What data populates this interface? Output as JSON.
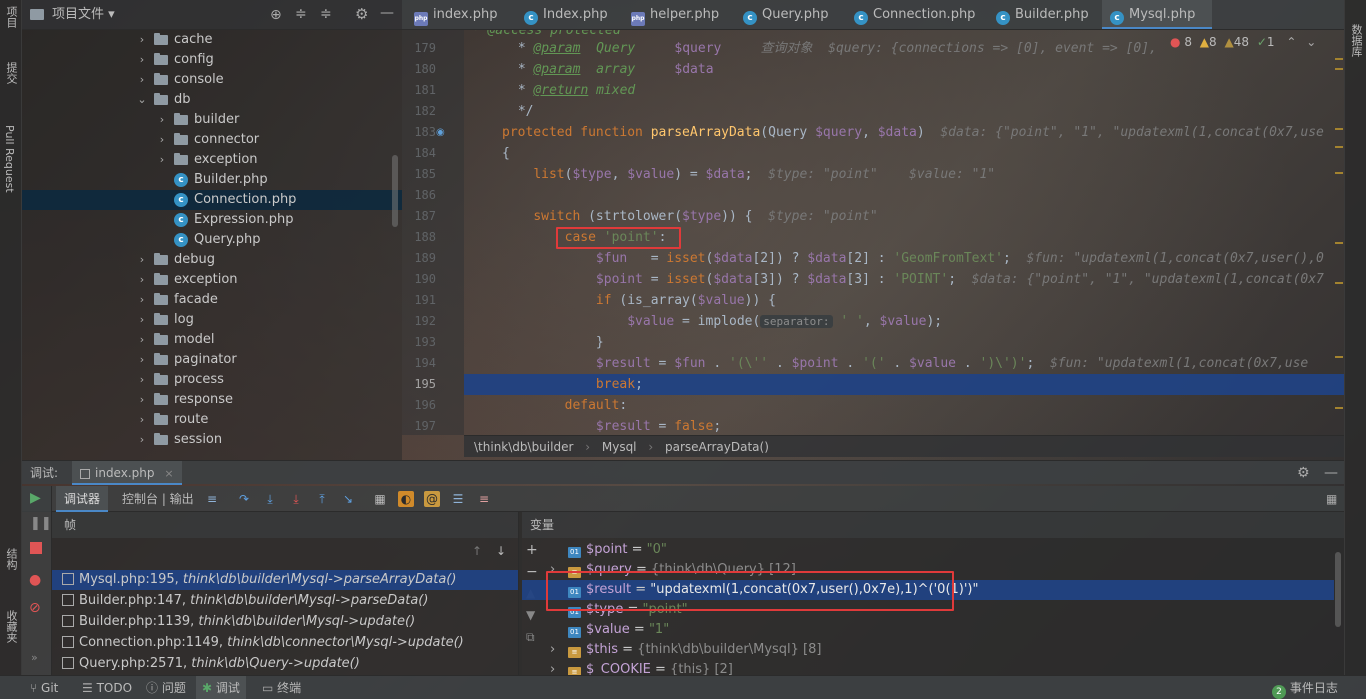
{
  "left_sidebar": {
    "tabs": [
      "项目",
      "提交",
      "Pull Request",
      "结构",
      "收藏夹"
    ]
  },
  "right_sidebar": {
    "tabs": [
      "数据库"
    ]
  },
  "project": {
    "title": "项目文件",
    "tree": [
      {
        "name": "cache",
        "type": "folder",
        "depth": 3,
        "expanded": false
      },
      {
        "name": "config",
        "type": "folder",
        "depth": 3,
        "expanded": false
      },
      {
        "name": "console",
        "type": "folder",
        "depth": 3,
        "expanded": false
      },
      {
        "name": "db",
        "type": "folder",
        "depth": 3,
        "expanded": true
      },
      {
        "name": "builder",
        "type": "folder",
        "depth": 4,
        "expanded": false
      },
      {
        "name": "connector",
        "type": "folder",
        "depth": 4,
        "expanded": false
      },
      {
        "name": "exception",
        "type": "folder",
        "depth": 4,
        "expanded": false
      },
      {
        "name": "Builder.php",
        "type": "class",
        "depth": 4
      },
      {
        "name": "Connection.php",
        "type": "class",
        "depth": 4,
        "selected": true
      },
      {
        "name": "Expression.php",
        "type": "class",
        "depth": 4
      },
      {
        "name": "Query.php",
        "type": "class",
        "depth": 4
      },
      {
        "name": "debug",
        "type": "folder",
        "depth": 3,
        "expanded": false
      },
      {
        "name": "exception",
        "type": "folder",
        "depth": 3,
        "expanded": false
      },
      {
        "name": "facade",
        "type": "folder",
        "depth": 3,
        "expanded": false
      },
      {
        "name": "log",
        "type": "folder",
        "depth": 3,
        "expanded": false
      },
      {
        "name": "model",
        "type": "folder",
        "depth": 3,
        "expanded": false
      },
      {
        "name": "paginator",
        "type": "folder",
        "depth": 3,
        "expanded": false
      },
      {
        "name": "process",
        "type": "folder",
        "depth": 3,
        "expanded": false
      },
      {
        "name": "response",
        "type": "folder",
        "depth": 3,
        "expanded": false
      },
      {
        "name": "route",
        "type": "folder",
        "depth": 3,
        "expanded": false
      },
      {
        "name": "session",
        "type": "folder",
        "depth": 3,
        "expanded": false
      }
    ]
  },
  "tabs": [
    {
      "label": "index.php",
      "kind": "php"
    },
    {
      "label": "Index.php",
      "kind": "class"
    },
    {
      "label": "helper.php",
      "kind": "php"
    },
    {
      "label": "Query.php",
      "kind": "class"
    },
    {
      "label": "Connection.php",
      "kind": "class"
    },
    {
      "label": "Builder.php",
      "kind": "class"
    },
    {
      "label": "Mysql.php",
      "kind": "class",
      "active": true
    }
  ],
  "inspections": {
    "errors": "8",
    "warnings": "8",
    "weak": "48",
    "ok": "1"
  },
  "editor": {
    "current_line": 195,
    "lines": [
      {
        "n": 179,
        "html": " * <span class='doc'>@param</span>  <span class='cmt'>Query</span>     <span class='var'>$query</span>     <span class='hint'>查询对象  $query: {connections => [0], event => [0], </span>"
      },
      {
        "n": 180,
        "html": " * <span class='doc'>@param</span>  <span class='cmt'>array</span>     <span class='var'>$data</span>"
      },
      {
        "n": 181,
        "html": " * <span class='doc'>@return</span> <span class='cmt'>mixed</span>"
      },
      {
        "n": 182,
        "html": " */"
      },
      {
        "n": 183,
        "html": "<span class='kw'>protected function</span> <span class='fn'>parseArrayData</span>(Query <span class='var'>$query</span>, <span class='var'>$data</span>)  <span class='hint'>$data: {\"point\", \"1\", \"updatexml(1,concat(0x7,use</span>"
      },
      {
        "n": 184,
        "html": "{"
      },
      {
        "n": 185,
        "html": "    <span class='kw'>list</span>(<span class='var'>$type</span>, <span class='var'>$value</span>) = <span class='var'>$data</span>;  <span class='hint'>$type: \"point\"    $value: \"1\"</span>"
      },
      {
        "n": 186,
        "html": ""
      },
      {
        "n": 187,
        "html": "    <span class='kw'>switch</span> (strtolower(<span class='var'>$type</span>)) {  <span class='hint'>$type: \"point\"</span>"
      },
      {
        "n": 188,
        "html": "        <span class='kw'>case</span> <span class='str'>'point'</span>:"
      },
      {
        "n": 189,
        "html": "            <span class='var'>$fun</span>   = <span class='kw'>isset</span>(<span class='var'>$data</span>[2]) ? <span class='var'>$data</span>[2] : <span class='str'>'GeomFromText'</span>;  <span class='hint'>$fun: \"updatexml(1,concat(0x7,user(),0</span>"
      },
      {
        "n": 190,
        "html": "            <span class='var'>$point</span> = <span class='kw'>isset</span>(<span class='var'>$data</span>[3]) ? <span class='var'>$data</span>[3] : <span class='str'>'POINT'</span>;  <span class='hint'>$data: {\"point\", \"1\", \"updatexml(1,concat(0x7</span>"
      },
      {
        "n": 191,
        "html": "            <span class='kw'>if</span> (is_array(<span class='var'>$value</span>)) {"
      },
      {
        "n": 192,
        "html": "                <span class='var'>$value</span> = implode(<span class='inlay'>separator:</span> <span class='str'>' '</span>, <span class='var'>$value</span>);"
      },
      {
        "n": 193,
        "html": "            }"
      },
      {
        "n": 194,
        "html": "            <span class='var'>$result</span> = <span class='var'>$fun</span> . <span class='str'>'(\\''</span> . <span class='var'>$point</span> . <span class='str'>'('</span> . <span class='var'>$value</span> . <span class='str'>')\\')'</span>;  <span class='hint'>$fun: \"updatexml(1,concat(0x7,use</span>"
      },
      {
        "n": 195,
        "html": "            <span class='kw'>break</span>;"
      },
      {
        "n": 196,
        "html": "        <span class='kw'>default</span>:"
      },
      {
        "n": 197,
        "html": "            <span class='var'>$result</span> = <span class='kw'>false</span>;"
      }
    ]
  },
  "breadcrumb": [
    "\\think\\db\\builder",
    "Mysql",
    "parseArrayData()"
  ],
  "debug": {
    "label": "调试:",
    "session": "index.php",
    "tab_debugger": "调试器",
    "tab_console": "控制台 | 输出",
    "frames_header": "帧",
    "vars_header": "变量",
    "frames": [
      {
        "loc": "Mysql.php:195,",
        "fn": "think\\db\\builder\\Mysql->parseArrayData()",
        "selected": true
      },
      {
        "loc": "Builder.php:147,",
        "fn": "think\\db\\builder\\Mysql->parseData()"
      },
      {
        "loc": "Builder.php:1139,",
        "fn": "think\\db\\builder\\Mysql->update()"
      },
      {
        "loc": "Connection.php:1149,",
        "fn": "think\\db\\connector\\Mysql->update()"
      },
      {
        "loc": "Query.php:2571,",
        "fn": "think\\db\\Query->update()"
      }
    ],
    "variables": [
      {
        "name": "$point",
        "eq": " = ",
        "value": "\"0\"",
        "kind": "str"
      },
      {
        "name": "$query",
        "eq": " = ",
        "value": "{think\\db\\Query} [12]",
        "kind": "obj",
        "expandable": true
      },
      {
        "name": "$result",
        "eq": " = ",
        "value": "\"updatexml(1,concat(0x7,user(),0x7e),1)^('0(1)')\"",
        "kind": "str",
        "selected": true
      },
      {
        "name": "$type",
        "eq": " = ",
        "value": "\"point\"",
        "kind": "str"
      },
      {
        "name": "$value",
        "eq": " = ",
        "value": "\"1\"",
        "kind": "str"
      },
      {
        "name": "$this",
        "eq": " = ",
        "value": "{think\\db\\builder\\Mysql} [8]",
        "kind": "obj",
        "expandable": true
      },
      {
        "name": "$_COOKIE",
        "eq": " = ",
        "value": "{this} [2]",
        "kind": "obj",
        "expandable": true
      }
    ]
  },
  "statusbar": {
    "items": [
      "Git",
      "TODO",
      "问题",
      "调试",
      "终端"
    ],
    "event_count": "2",
    "event_label": "事件日志"
  }
}
